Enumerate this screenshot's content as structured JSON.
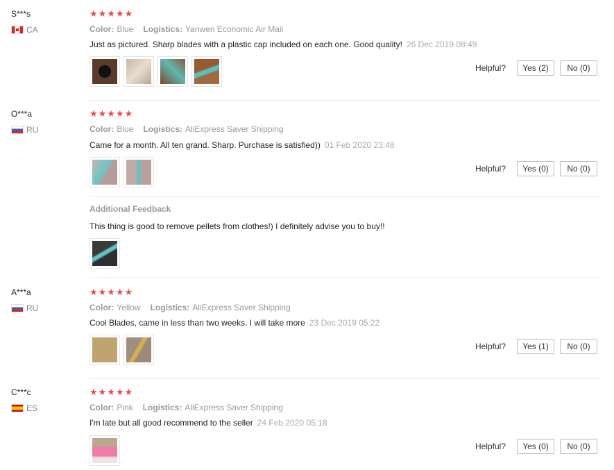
{
  "helpful_label": "Helpful?",
  "color_label": "Color:",
  "logistics_label": "Logistics:",
  "stars": "★★★★★",
  "reviews": [
    {
      "user": "S***s",
      "country": "CA",
      "color": "Blue",
      "logistics": "Yanwen Economic Air Mail",
      "text": "Just as pictured. Sharp blades with a plastic cap included on each one. Good quality!",
      "date": "26 Dec 2019 08:49",
      "yes": "Yes (2)",
      "no": "No (0)"
    },
    {
      "user": "O***a",
      "country": "RU",
      "color": "Blue",
      "logistics": "AliExpress Saver Shipping",
      "text": "Came for a month. All ten grand. Sharp. Purchase is satisfied))",
      "date": "01 Feb 2020 23:48",
      "yes": "Yes (0)",
      "no": "No (0)",
      "additional_title": "Additional Feedback",
      "additional_text": "This thing is good to remove pellets from clothes!) I definitely advise you to buy!!"
    },
    {
      "user": "A***a",
      "country": "RU",
      "color": "Yellow",
      "logistics": "AliExpress Saver Shipping",
      "text": "Cool Blades, came in less than two weeks. I will take more",
      "date": "23 Dec 2019 05:22",
      "yes": "Yes (1)",
      "no": "No (0)"
    },
    {
      "user": "C***c",
      "country": "ES",
      "color": "Pink",
      "logistics": "AliExpress Saver Shipping",
      "text": "I'm late but all good recommend to the seller",
      "date": "24 Feb 2020 05:18",
      "yes": "Yes (0)",
      "no": "No (0)"
    }
  ],
  "colors": {
    "star": "#e84c4c",
    "divider": "#ececec"
  }
}
